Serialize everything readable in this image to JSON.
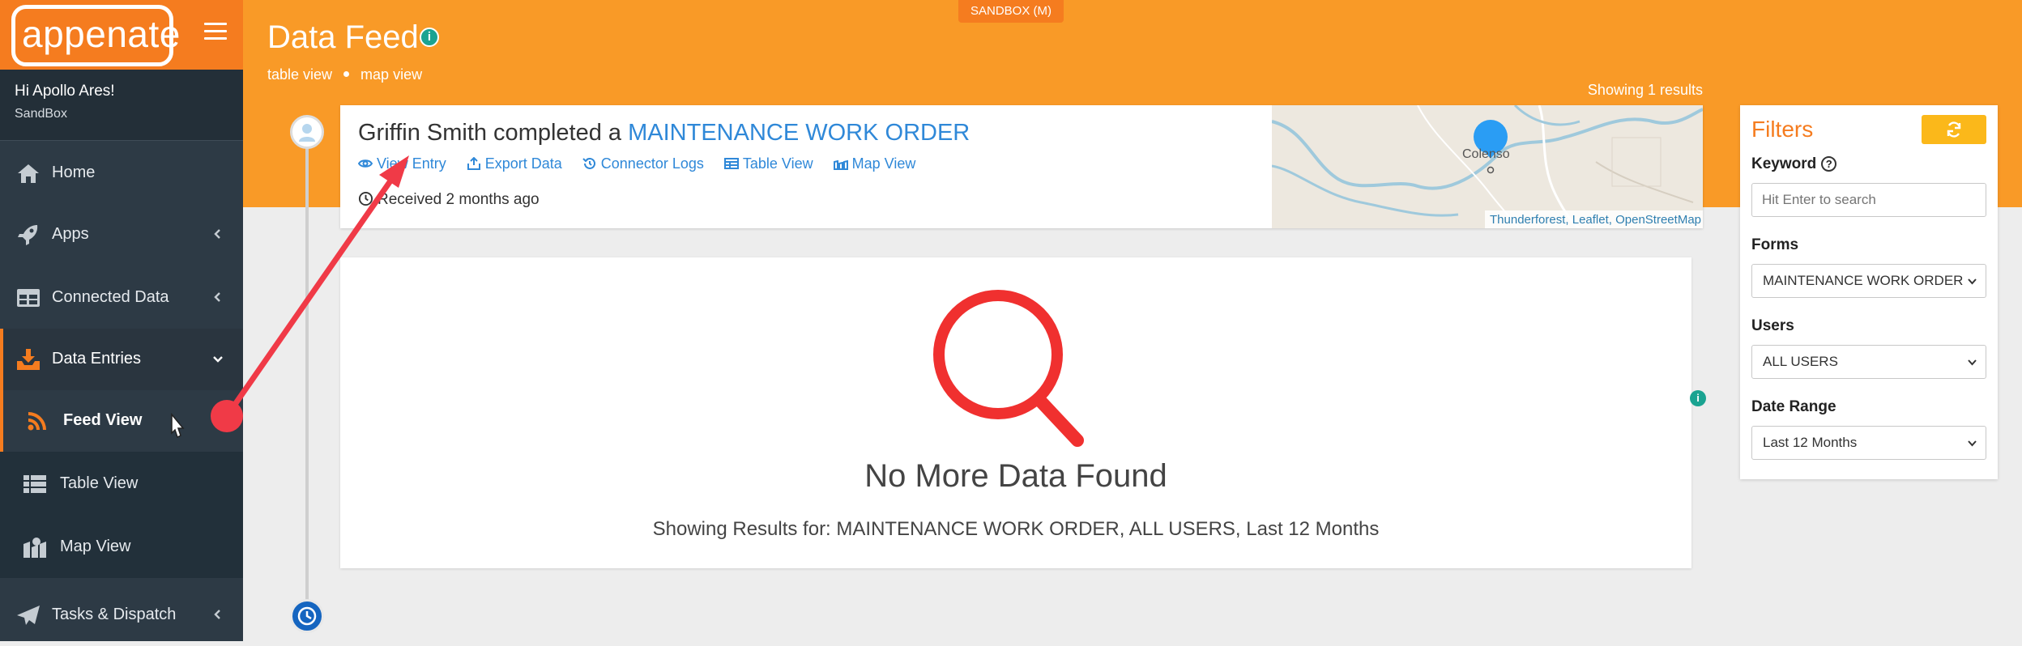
{
  "brand": {
    "logo_text": "appenate"
  },
  "sandbox_badge": "SANDBOX (M)",
  "user": {
    "greeting": "Hi Apollo Ares!",
    "org": "SandBox"
  },
  "nav": {
    "home": "Home",
    "apps": "Apps",
    "connected_data": "Connected Data",
    "data_entries": "Data Entries",
    "feed_view": "Feed View",
    "table_view": "Table View",
    "map_view": "Map View",
    "tasks_dispatch": "Tasks & Dispatch"
  },
  "header": {
    "title": "Data Feed",
    "info_icon": "i",
    "view_links": [
      "table view",
      "map view"
    ],
    "showing": "Showing 1 results"
  },
  "entry": {
    "user_text": "Griffin Smith completed a ",
    "form_name": "MAINTENANCE WORK ORDER",
    "actions": [
      "View Entry",
      "Export Data",
      "Connector Logs",
      "Table View",
      "Map View"
    ],
    "received": "Received 2 months ago",
    "map": {
      "town": "Colenso",
      "attribution": "Thunderforest, Leaflet, OpenStreetMap"
    }
  },
  "nodata": {
    "title": "No More Data Found",
    "detail": "Showing Results for: MAINTENANCE WORK ORDER, ALL USERS, Last 12 Months",
    "side_info": "i"
  },
  "filters": {
    "title": "Filters",
    "keyword_label": "Keyword",
    "keyword_help": "?",
    "keyword_placeholder": "Hit Enter to search",
    "forms_label": "Forms",
    "forms_value": "MAINTENANCE WORK ORDER",
    "users_label": "Users",
    "users_value": "ALL USERS",
    "date_label": "Date Range",
    "date_value": "Last 12 Months"
  },
  "colors": {
    "brand_orange": "#f57c1f",
    "header_orange": "#f99a27",
    "sidebar": "#2d3a45",
    "link_blue": "#2f88d8",
    "annotation_red": "#f03a47"
  },
  "icons": [
    "home-icon",
    "rocket-icon",
    "table-icon",
    "inbox-download-icon",
    "rss-icon",
    "list-icon",
    "map-icon",
    "paper-plane-icon",
    "eye-icon",
    "export-icon",
    "history-icon",
    "map-pin-icon",
    "clock-icon",
    "search-icon",
    "refresh-icon"
  ]
}
